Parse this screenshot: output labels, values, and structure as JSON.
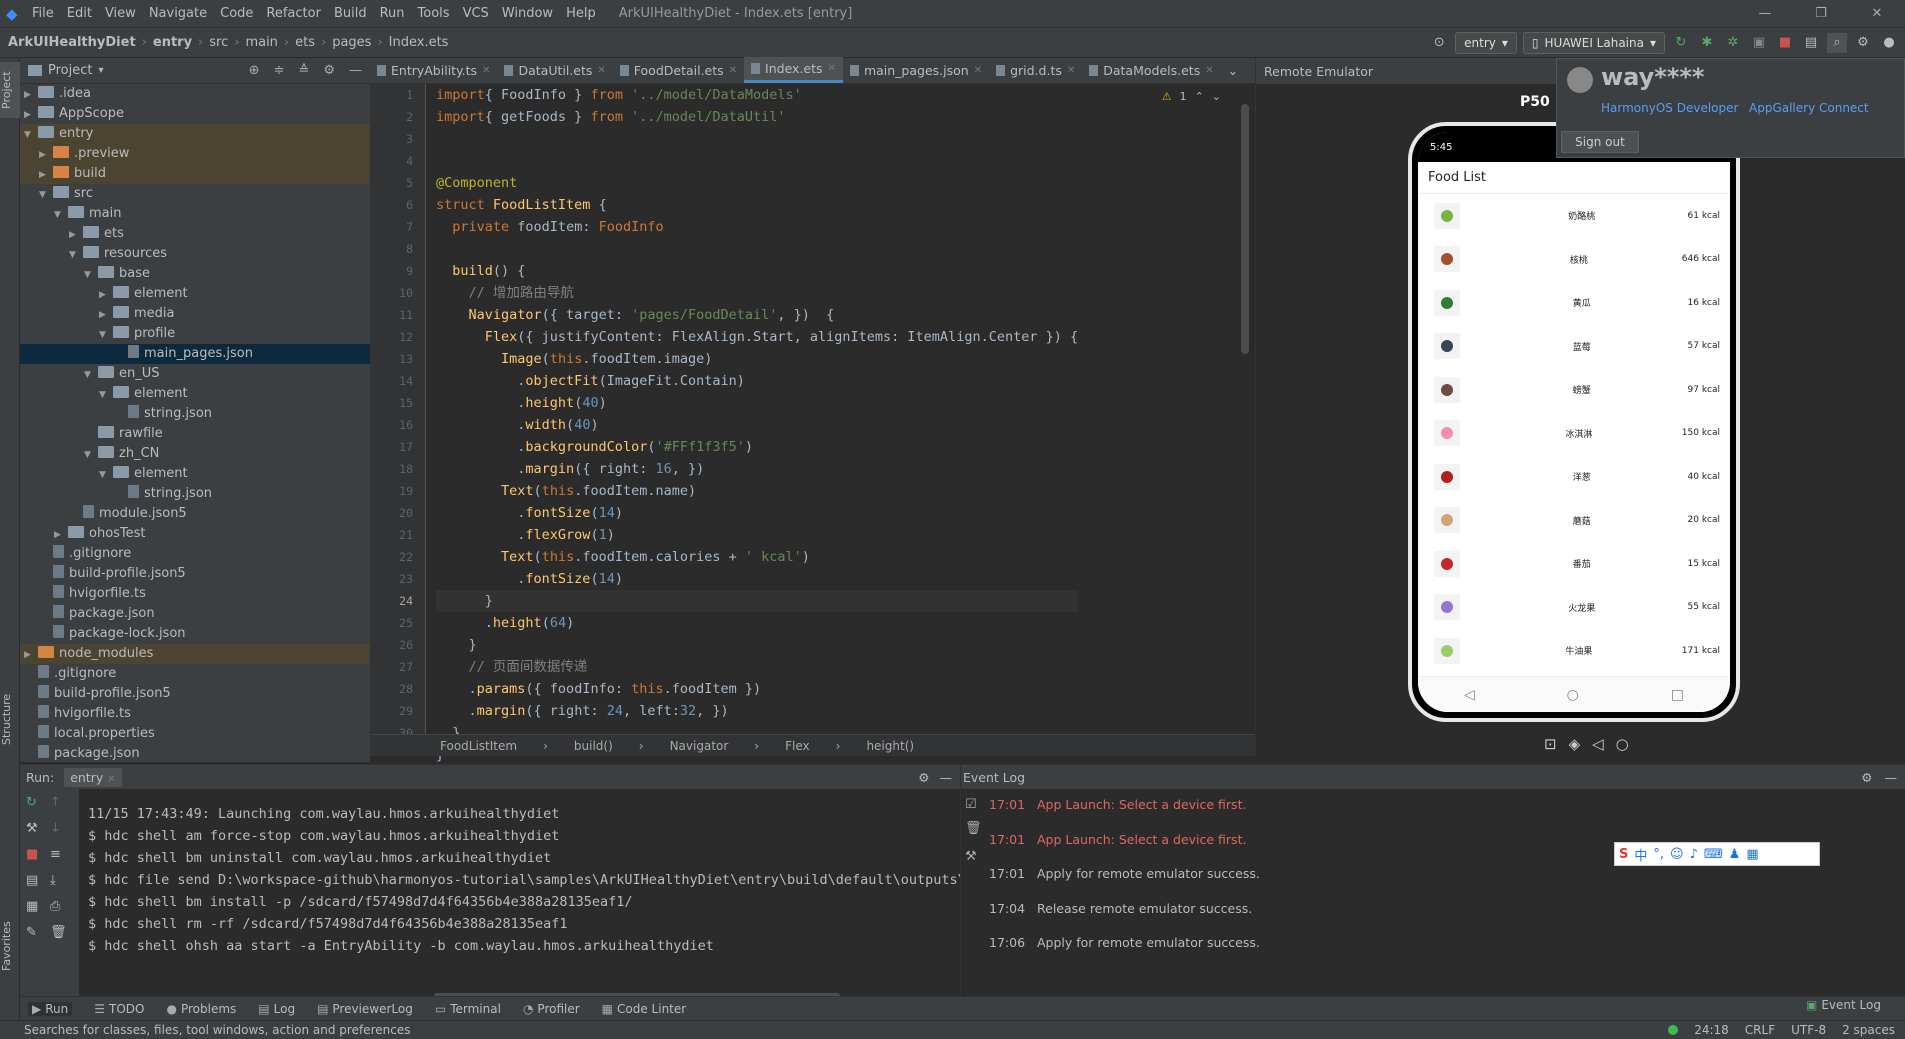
{
  "window": {
    "menu": [
      "File",
      "Edit",
      "View",
      "Navigate",
      "Code",
      "Refactor",
      "Build",
      "Run",
      "Tools",
      "VCS",
      "Window",
      "Help"
    ],
    "title": "ArkUIHealthyDiet - Index.ets [entry]"
  },
  "breadcrumb": [
    "ArkUIHealthyDiet",
    "entry",
    "src",
    "main",
    "ets",
    "pages",
    "Index.ets"
  ],
  "toolbar": {
    "run_config": "entry",
    "device": "HUAWEI Lahaina"
  },
  "project": {
    "title": "Project",
    "tree": [
      {
        "label": ".idea",
        "arr": "▶",
        "icon": "fold",
        "depth": 1
      },
      {
        "label": "AppScope",
        "arr": "▶",
        "icon": "fold",
        "depth": 1
      },
      {
        "label": "entry",
        "arr": "▼",
        "icon": "fold",
        "depth": 1,
        "hl": true
      },
      {
        "label": ".preview",
        "arr": "▶",
        "icon": "foldo",
        "depth": 2,
        "hl": true
      },
      {
        "label": "build",
        "arr": "▶",
        "icon": "foldo",
        "depth": 2,
        "hl": true
      },
      {
        "label": "src",
        "arr": "▼",
        "icon": "fold",
        "depth": 2
      },
      {
        "label": "main",
        "arr": "▼",
        "icon": "fold",
        "depth": 3
      },
      {
        "label": "ets",
        "arr": "▶",
        "icon": "fold",
        "depth": 4
      },
      {
        "label": "resources",
        "arr": "▼",
        "icon": "fold",
        "depth": 4
      },
      {
        "label": "base",
        "arr": "▼",
        "icon": "fold",
        "depth": 5
      },
      {
        "label": "element",
        "arr": "▶",
        "icon": "fold",
        "depth": 6
      },
      {
        "label": "media",
        "arr": "▶",
        "icon": "fold",
        "depth": 6
      },
      {
        "label": "profile",
        "arr": "▼",
        "icon": "fold",
        "depth": 6
      },
      {
        "label": "main_pages.json",
        "arr": "",
        "icon": "file",
        "depth": 7,
        "sel": true
      },
      {
        "label": "en_US",
        "arr": "▼",
        "icon": "fold",
        "depth": 5
      },
      {
        "label": "element",
        "arr": "▼",
        "icon": "fold",
        "depth": 6
      },
      {
        "label": "string.json",
        "arr": "",
        "icon": "file",
        "depth": 7
      },
      {
        "label": "rawfile",
        "arr": "",
        "icon": "fold",
        "depth": 5
      },
      {
        "label": "zh_CN",
        "arr": "▼",
        "icon": "fold",
        "depth": 5
      },
      {
        "label": "element",
        "arr": "▼",
        "icon": "fold",
        "depth": 6
      },
      {
        "label": "string.json",
        "arr": "",
        "icon": "file",
        "depth": 7
      },
      {
        "label": "module.json5",
        "arr": "",
        "icon": "file",
        "depth": 4
      },
      {
        "label": "ohosTest",
        "arr": "▶",
        "icon": "fold",
        "depth": 3
      },
      {
        "label": ".gitignore",
        "arr": "",
        "icon": "file",
        "depth": 2
      },
      {
        "label": "build-profile.json5",
        "arr": "",
        "icon": "file",
        "depth": 2
      },
      {
        "label": "hvigorfile.ts",
        "arr": "",
        "icon": "file",
        "depth": 2
      },
      {
        "label": "package.json",
        "arr": "",
        "icon": "file",
        "depth": 2
      },
      {
        "label": "package-lock.json",
        "arr": "",
        "icon": "file",
        "depth": 2
      },
      {
        "label": "node_modules",
        "arr": "▶",
        "icon": "foldo",
        "depth": 1,
        "hl": true
      },
      {
        "label": ".gitignore",
        "arr": "",
        "icon": "file",
        "depth": 1
      },
      {
        "label": "build-profile.json5",
        "arr": "",
        "icon": "file",
        "depth": 1
      },
      {
        "label": "hvigorfile.ts",
        "arr": "",
        "icon": "file",
        "depth": 1
      },
      {
        "label": "local.properties",
        "arr": "",
        "icon": "file",
        "depth": 1
      },
      {
        "label": "package.json",
        "arr": "",
        "icon": "file",
        "depth": 1
      }
    ]
  },
  "tabs": [
    {
      "label": "EntryAbility.ts",
      "active": false
    },
    {
      "label": "DataUtil.ets",
      "active": false
    },
    {
      "label": "FoodDetail.ets",
      "active": false
    },
    {
      "label": "Index.ets",
      "active": true
    },
    {
      "label": "main_pages.json",
      "active": false
    },
    {
      "label": "grid.d.ts",
      "active": false
    },
    {
      "label": "DataModels.ets",
      "active": false
    }
  ],
  "editor": {
    "warning_count": "1",
    "line_numbers": [
      "1",
      "2",
      "3",
      "4",
      "5",
      "6",
      "7",
      "8",
      "9",
      "10",
      "11",
      "12",
      "13",
      "14",
      "15",
      "16",
      "17",
      "18",
      "19",
      "20",
      "21",
      "22",
      "23",
      "24",
      "25",
      "26",
      "27",
      "28",
      "29",
      "30"
    ],
    "lines": [
      [
        [
          "kw",
          "import"
        ],
        [
          "",
          "{ FoodInfo } "
        ],
        [
          "kw",
          "from "
        ],
        [
          "str",
          "'../model/DataModels'"
        ]
      ],
      [
        [
          "kw",
          "import"
        ],
        [
          "",
          "{ getFoods } "
        ],
        [
          "kw",
          "from "
        ],
        [
          "str",
          "'../model/DataUtil'"
        ]
      ],
      [],
      [],
      [
        [
          "ann",
          "@Component"
        ]
      ],
      [
        [
          "kw",
          "struct "
        ],
        [
          "fn",
          "FoodListItem "
        ],
        [
          "",
          "{"
        ]
      ],
      [
        [
          "",
          "  "
        ],
        [
          "kw",
          "private "
        ],
        [
          "",
          "foodItem: "
        ],
        [
          "kw",
          "FoodInfo"
        ]
      ],
      [],
      [
        [
          "",
          "  "
        ],
        [
          "fn",
          "build"
        ],
        [
          "",
          "() {"
        ]
      ],
      [
        [
          "",
          "    "
        ],
        [
          "cm",
          "// 增加路由导航"
        ]
      ],
      [
        [
          "",
          "    "
        ],
        [
          "fn",
          "Navigator"
        ],
        [
          "",
          "({ target: "
        ],
        [
          "str",
          "'pages/FoodDetail'"
        ],
        [
          "",
          ", })  {"
        ]
      ],
      [
        [
          "",
          "      "
        ],
        [
          "fn",
          "Flex"
        ],
        [
          "",
          "({ justifyContent: FlexAlign.Start, alignItems: ItemAlign.Center }) {"
        ]
      ],
      [
        [
          "",
          "        "
        ],
        [
          "fn",
          "Image"
        ],
        [
          "",
          "("
        ],
        [
          "kw",
          "this"
        ],
        [
          "",
          ".foodItem.image)"
        ]
      ],
      [
        [
          "",
          "          ."
        ],
        [
          "fn",
          "objectFit"
        ],
        [
          "",
          "(ImageFit.Contain)"
        ]
      ],
      [
        [
          "",
          "          ."
        ],
        [
          "fn",
          "height"
        ],
        [
          "",
          "("
        ],
        [
          "num",
          "40"
        ],
        [
          "",
          ")"
        ]
      ],
      [
        [
          "",
          "          ."
        ],
        [
          "fn",
          "width"
        ],
        [
          "",
          "("
        ],
        [
          "num",
          "40"
        ],
        [
          "",
          ")"
        ]
      ],
      [
        [
          "",
          "          ."
        ],
        [
          "fn",
          "backgroundColor"
        ],
        [
          "",
          "("
        ],
        [
          "str",
          "'#FFf1f3f5'"
        ],
        [
          "",
          ")"
        ]
      ],
      [
        [
          "",
          "          ."
        ],
        [
          "fn",
          "margin"
        ],
        [
          "",
          "({ right: "
        ],
        [
          "num",
          "16"
        ],
        [
          "",
          ", })"
        ]
      ],
      [
        [
          "",
          "        "
        ],
        [
          "fn",
          "Text"
        ],
        [
          "",
          "("
        ],
        [
          "kw",
          "this"
        ],
        [
          "",
          ".foodItem.name)"
        ]
      ],
      [
        [
          "",
          "          ."
        ],
        [
          "fn",
          "fontSize"
        ],
        [
          "",
          "("
        ],
        [
          "num",
          "14"
        ],
        [
          "",
          ")"
        ]
      ],
      [
        [
          "",
          "          ."
        ],
        [
          "fn",
          "flexGrow"
        ],
        [
          "",
          "("
        ],
        [
          "num",
          "1"
        ],
        [
          "",
          ")"
        ]
      ],
      [
        [
          "",
          "        "
        ],
        [
          "fn",
          "Text"
        ],
        [
          "",
          "("
        ],
        [
          "kw",
          "this"
        ],
        [
          "",
          ".foodItem.calories + "
        ],
        [
          "str",
          "' kcal'"
        ],
        [
          "",
          ")"
        ]
      ],
      [
        [
          "",
          "          ."
        ],
        [
          "fn",
          "fontSize"
        ],
        [
          "",
          "("
        ],
        [
          "num",
          "14"
        ],
        [
          "",
          ")"
        ]
      ],
      [
        [
          "",
          "      }"
        ]
      ],
      [
        [
          "",
          "      ."
        ],
        [
          "fn",
          "height"
        ],
        [
          "",
          "("
        ],
        [
          "num",
          "64"
        ],
        [
          "",
          ")"
        ]
      ],
      [
        [
          "",
          "    }"
        ]
      ],
      [
        [
          "",
          "    "
        ],
        [
          "cm",
          "// 页面间数据传递"
        ]
      ],
      [
        [
          "",
          "    ."
        ],
        [
          "fn",
          "params"
        ],
        [
          "",
          "({ foodInfo: "
        ],
        [
          "kw",
          "this"
        ],
        [
          "",
          ".foodItem })"
        ]
      ],
      [
        [
          "",
          "    ."
        ],
        [
          "fn",
          "margin"
        ],
        [
          "",
          "({ right: "
        ],
        [
          "num",
          "24"
        ],
        [
          "",
          ", left:"
        ],
        [
          "num",
          "32"
        ],
        [
          "",
          ", })"
        ]
      ],
      [
        [
          "",
          "  }"
        ]
      ],
      [
        [
          "",
          "}"
        ]
      ]
    ],
    "footer": [
      "FoodListItem",
      "build()",
      "Navigator",
      "Flex",
      "height()"
    ]
  },
  "emulator": {
    "panel_title": "Remote Emulator",
    "device_label": "P50",
    "status_time": "5:45",
    "app_title": "Food List",
    "foods": [
      {
        "name": "奶酪桃",
        "kcal": "61 kcal",
        "color": "#7cb342"
      },
      {
        "name": "核桃",
        "kcal": "646 kcal",
        "color": "#a0522d"
      },
      {
        "name": "黄瓜",
        "kcal": "16 kcal",
        "color": "#2e7d32"
      },
      {
        "name": "蓝莓",
        "kcal": "57 kcal",
        "color": "#37474f"
      },
      {
        "name": "螃蟹",
        "kcal": "97 kcal",
        "color": "#6d4c41"
      },
      {
        "name": "冰淇淋",
        "kcal": "150 kcal",
        "color": "#f48fb1"
      },
      {
        "name": "洋葱",
        "kcal": "40 kcal",
        "color": "#b71c1c"
      },
      {
        "name": "蘑菇",
        "kcal": "20 kcal",
        "color": "#d4a373"
      },
      {
        "name": "番茄",
        "kcal": "15 kcal",
        "color": "#c62828"
      },
      {
        "name": "火龙果",
        "kcal": "55 kcal",
        "color": "#9575cd"
      },
      {
        "name": "牛油果",
        "kcal": "171 kcal",
        "color": "#9ccc65"
      }
    ]
  },
  "account": {
    "user": "way****",
    "link1": "HarmonyOS Developer",
    "link2": "AppGallery Connect",
    "signout": "Sign out"
  },
  "run": {
    "label": "Run:",
    "tab": "entry",
    "console": [
      "11/15 17:43:49: Launching com.waylau.hmos.arkuihealthydiet",
      "$ hdc shell am force-stop com.waylau.hmos.arkuihealthydiet",
      "$ hdc shell bm uninstall com.waylau.hmos.arkuihealthydiet",
      "$ hdc file send D:\\workspace-github\\harmonyos-tutorial\\samples\\ArkUIHealthyDiet\\entry\\build\\default\\outputs\\d",
      "$ hdc shell bm install -p /sdcard/f57498d7d4f64356b4e388a28135eaf1/",
      "$ hdc shell rm -rf /sdcard/f57498d7d4f64356b4e388a28135eaf1",
      "$ hdc shell ohsh aa start -a EntryAbility -b com.waylau.hmos.arkuihealthydiet"
    ]
  },
  "eventlog": {
    "title": "Event Log",
    "events": [
      {
        "time": "17:01",
        "msg": "App Launch: Select a device first.",
        "color": "#e0665e"
      },
      {
        "time": "17:01",
        "msg": "App Launch: Select a device first.",
        "color": "#e0665e"
      },
      {
        "time": "17:01",
        "msg": "Apply for remote emulator success.",
        "color": "#bbbbbb"
      },
      {
        "time": "17:04",
        "msg": "Release remote emulator success.",
        "color": "#bbbbbb"
      },
      {
        "time": "17:06",
        "msg": "Apply for remote emulator success.",
        "color": "#bbbbbb"
      }
    ]
  },
  "bottom_tabs": [
    "Run",
    "TODO",
    "Problems",
    "Log",
    "PreviewerLog",
    "Terminal",
    "Profiler",
    "Code Linter"
  ],
  "bottom_right_tab": "Event Log",
  "statusbar": {
    "hint": "Searches for classes, files, tool windows, action and preferences",
    "pos": "24:18",
    "eol": "CRLF",
    "enc": "UTF-8",
    "indent": "2 spaces"
  },
  "left_strip": [
    "Project",
    "Structure",
    "Favorites"
  ]
}
